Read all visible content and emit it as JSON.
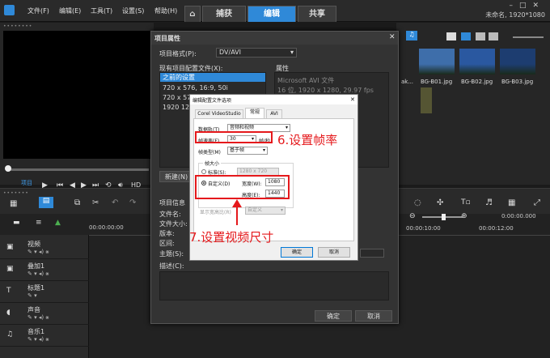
{
  "menu": {
    "file": "文件(F)",
    "edit": "编辑(E)",
    "tools": "工具(T)",
    "settings": "设置(S)",
    "help": "帮助(H)"
  },
  "tabs": {
    "capture": "捕获",
    "edit": "编辑",
    "share": "共享"
  },
  "window": {
    "project_info": "未命名, 1920*1080"
  },
  "player": {
    "project_label": "项目",
    "clip_label": "素材",
    "hd_label": "HD"
  },
  "library": {
    "thumbs": [
      {
        "label": "ak..."
      },
      {
        "label": "BG-B01.jpg"
      },
      {
        "label": "BG-B02.jpg"
      },
      {
        "label": "BG-B03.jpg"
      }
    ],
    "thumb_colors": [
      "#4f7fb8",
      "#3e6eaa",
      "#2a58a0",
      "#1d3d70"
    ]
  },
  "timeline": {
    "time_start": "00:00:00:00",
    "time_right_1": "00:00:10:00",
    "time_right_2": "00:00:12:00",
    "timecode": "0:00:00.000",
    "tracks": [
      {
        "label": "视频"
      },
      {
        "label": "叠加1"
      },
      {
        "label": "标题1"
      },
      {
        "label": "声音"
      },
      {
        "label": "音乐1"
      }
    ]
  },
  "project_dialog": {
    "title": "项目属性",
    "format_label": "项目格式(P):",
    "format_value": "DV/AVI",
    "profiles_label": "现有项目配置文件(X):",
    "properties_label": "属性",
    "profiles": [
      "之前的设置",
      "720 x 576, 16:9, 50i",
      "720 x 576",
      "1920 1280"
    ],
    "properties_lines": [
      "Microsoft AVI 文件",
      "16 位, 1920 x 1280, 29.97 fps"
    ],
    "new_button": "新建(N)",
    "info_label": "项目信息",
    "info_fields": [
      "文件名:",
      "文件大小:",
      "版本:",
      "区间:",
      "主题(S):"
    ],
    "description_label": "描述(C):",
    "ok": "确定",
    "cancel": "取消"
  },
  "edit_dialog": {
    "title": "编辑配置文件选项",
    "tabs": [
      "Corel VideoStudio",
      "常规",
      "AVI"
    ],
    "data_track_label": "数据轨(T)",
    "data_track_value": "音频和视频",
    "frame_rate_label": "帧速率(F)",
    "frame_rate_value": "30",
    "frame_rate_unit": "帧/秒",
    "frame_type_label": "帧类型(M)",
    "frame_type_value": "基于帧",
    "frame_size_label": "帧大小",
    "standard_label": "标准(S):",
    "standard_value": "1280 x 720",
    "custom_label": "自定义(D)",
    "width_label": "宽度(W):",
    "width_value": "1080",
    "height_label": "高度(E):",
    "height_value": "1440",
    "aspect_label": "显示宽高比(R)",
    "aspect_value": "自定义",
    "ok": "确定",
    "cancel": "取消"
  },
  "annotations": {
    "step6": "6.设置帧率",
    "step7": "7.设置视频尺寸"
  },
  "colors": {
    "accent": "#2f89d8",
    "annotation_red": "#e5191c"
  }
}
